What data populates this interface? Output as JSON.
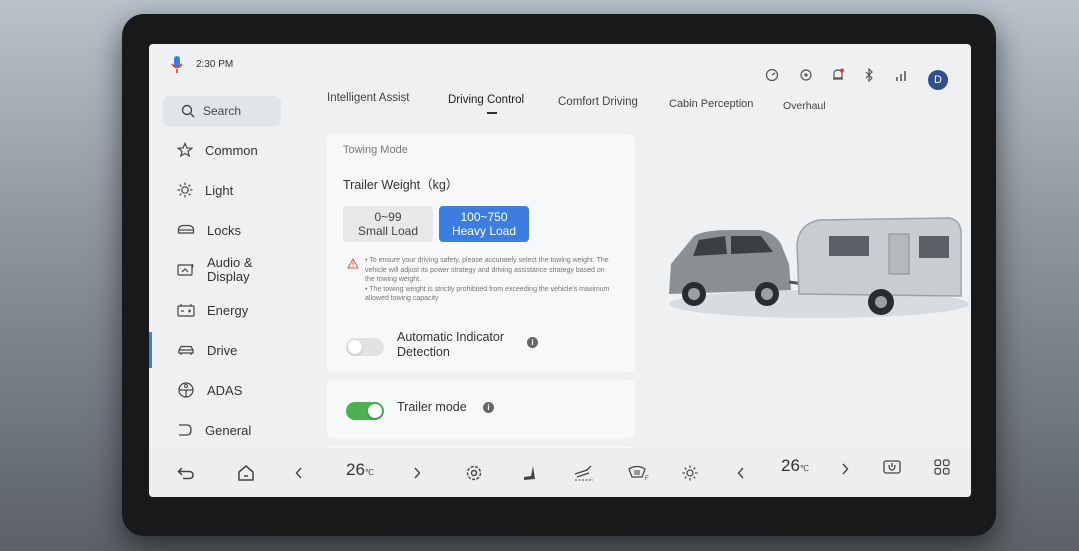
{
  "status": {
    "time": "2:30 PM",
    "user_initial": "D"
  },
  "sidebar": {
    "search_label": "Search",
    "items": [
      {
        "label": "Common",
        "icon": "star-icon"
      },
      {
        "label": "Light",
        "icon": "sun-icon"
      },
      {
        "label": "Locks",
        "icon": "lock-icon"
      },
      {
        "label": "Audio & Display",
        "icon": "audio-display-icon"
      },
      {
        "label": "Energy",
        "icon": "battery-icon"
      },
      {
        "label": "Drive",
        "icon": "car-icon",
        "active": true
      },
      {
        "label": "ADAS",
        "icon": "steering-wheel-icon"
      },
      {
        "label": "General",
        "icon": "general-icon"
      }
    ]
  },
  "tabs": [
    {
      "label": "Intelligent Assist"
    },
    {
      "label": "Driving Control",
      "active": true
    },
    {
      "label": "Comfort Driving"
    },
    {
      "label": "Cabin Perception"
    },
    {
      "label": "Overhaul"
    }
  ],
  "towing": {
    "section_label": "Towing Mode",
    "trailer_weight_label": "Trailer Weight（kg）",
    "options": [
      {
        "range": "0~99",
        "name": "Small Load",
        "selected": false
      },
      {
        "range": "100~750",
        "name": "Heavy Load",
        "selected": true
      }
    ],
    "warning": "• To ensure your driving safety, please accurately select the towing weight. The vehicle will adjust its power strategy and driving assistance strategy based on the towing weight.\n• The towing weight is strictly prohibited from exceeding the vehicle's maximum allowed towing capacity",
    "auto_indicator_label": "Automatic Indicator Detection",
    "auto_indicator_on": false
  },
  "trailer_mode": {
    "label": "Trailer mode",
    "on": true
  },
  "bottom_bar": {
    "left_temp": "26",
    "right_temp": "26",
    "temp_unit": "℃"
  },
  "colors": {
    "accent": "#3b7de0",
    "toggle_on": "#4caf50"
  }
}
